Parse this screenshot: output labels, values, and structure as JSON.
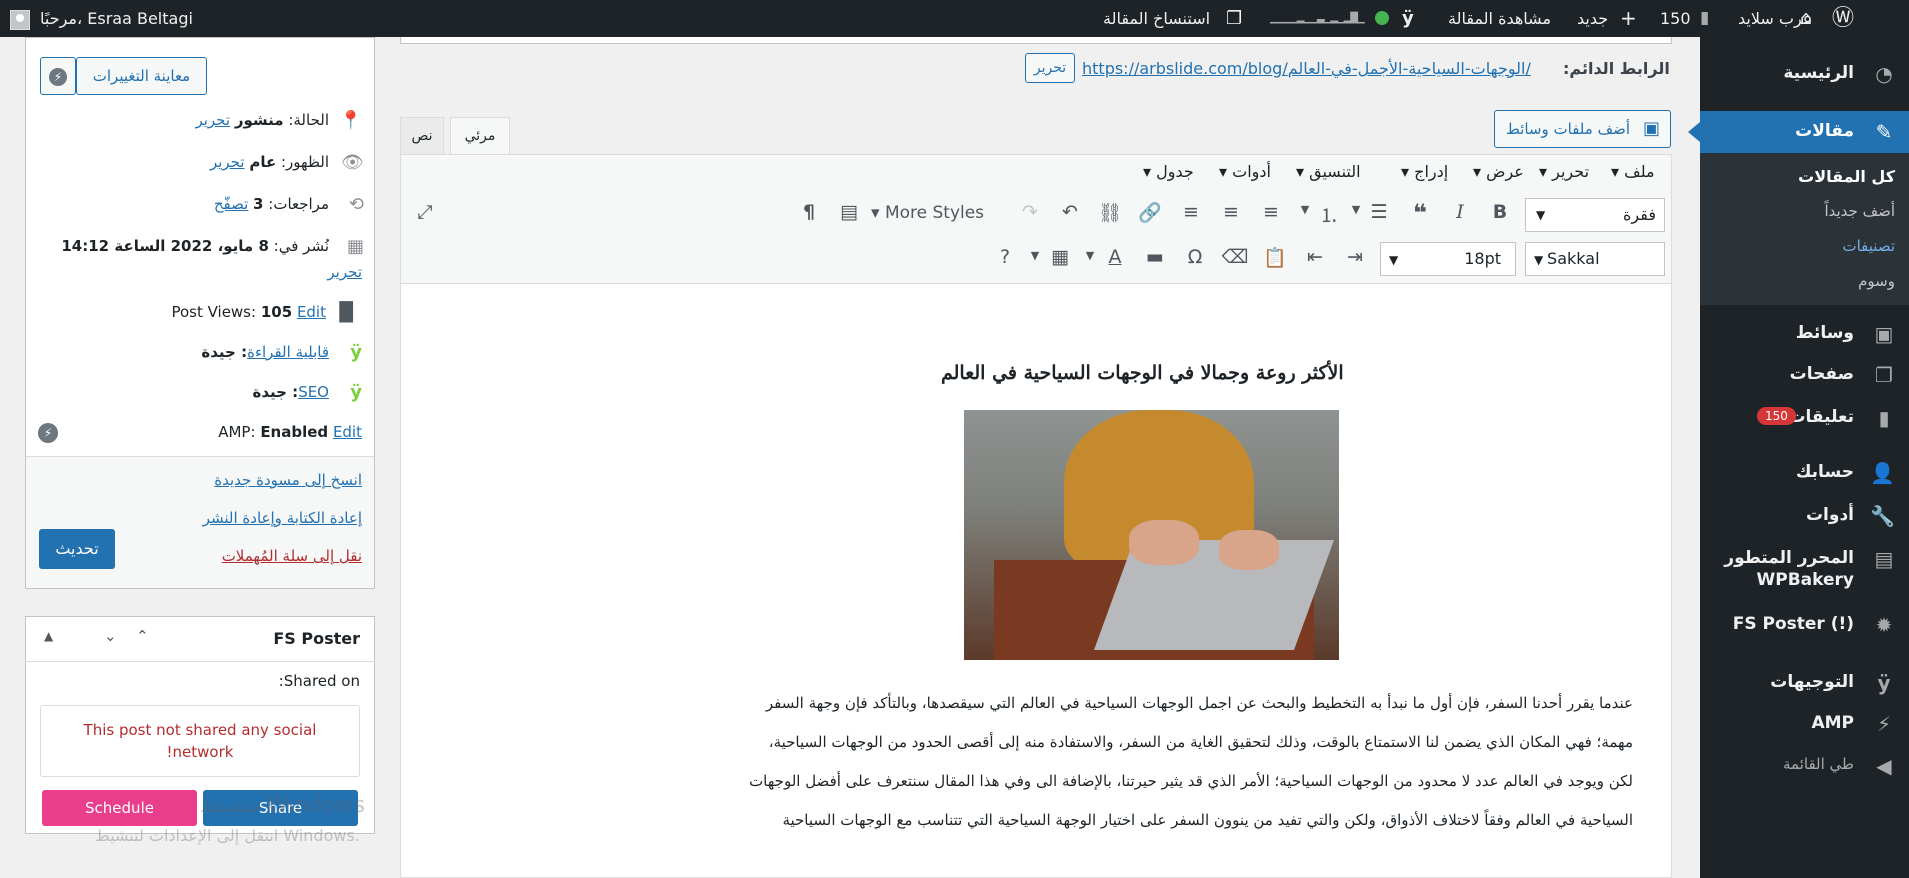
{
  "adminbar": {
    "site_name": "عرب سلايد",
    "updates_count": "150",
    "new_label": "جديد",
    "view_post": "مشاهدة المقالة",
    "clone_post": "استنساخ المقالة",
    "greeting": "مرحبًا، Esraa Beltagi"
  },
  "menu": {
    "items": [
      {
        "label": "الرئيسية",
        "icon": "dashboard-icon"
      },
      {
        "label": "مقالات",
        "icon": "pin-icon"
      },
      {
        "label": "وسائط",
        "icon": "media-icon"
      },
      {
        "label": "صفحات",
        "icon": "pages-icon"
      },
      {
        "label": "تعليقات",
        "icon": "comments-icon",
        "badge": "150"
      },
      {
        "label": "حسابك",
        "icon": "user-icon"
      },
      {
        "label": "أدوات",
        "icon": "wrench-icon"
      },
      {
        "label": "المحرر المتطور",
        "label2": "WPBakery",
        "icon": "wpbakery-icon"
      },
      {
        "label": "FS Poster (!)",
        "icon": "fs-poster-icon"
      },
      {
        "label": "التوجيهات",
        "icon": "yoast-icon"
      },
      {
        "label": "AMP",
        "icon": "amp-icon"
      },
      {
        "label": "طي القائمة",
        "icon": "collapse-icon"
      }
    ],
    "submenu": [
      "كل المقالات",
      "أضف جديداً",
      "تصنيفات",
      "وسوم"
    ]
  },
  "editor": {
    "permalink_label": "الرابط الدائم:",
    "permalink_url": "https://arbslide.com/blog/الوجهات-السياحية-الأجمل-في-العالم/",
    "permalink_edit": "تحرير",
    "add_media": "أضف ملفات وسائط",
    "tab_visual": "مرئي",
    "tab_text": "نص",
    "menubar": [
      "ملف",
      "تحرير",
      "عرض",
      "إدراج",
      "التنسيق",
      "أدوات",
      "جدول"
    ],
    "format_select": "فقرة",
    "more_styles": "More Styles",
    "font_select": "Sakkal Majalla",
    "size_select": "18pt",
    "heading": "الأكثر روعة وجمالا في الوجهات السياحية في العالم",
    "paragraph_lines": [
      "عندما يقرر أحدنا السفر، فإن أول ما نبدأ به التخطيط  والبحث عن  اجمل الوجهات السياحية في العالم التي سيقصدها، وبالتأكد فإن وجهة السفر",
      "مهمة؛ فهي المكان الذي يضمن لنا الاستمتاع بالوقت، وذلك لتحقيق الغاية من السفر، والاستفادة منه إلى أقصى الحدود من الوجهات السياحية،",
      "لكن ويوجد في العالم عدد لا محدود من الوجهات السياحية؛ الأمر الذي قد يثير حيرتنا،  بالإضافة الى وفي هذا المقال سنتعرف على أفضل الوجهات",
      "السياحية في العالم وفقاً لاختلاف الأذواق،  ولكن والتي تفيد من ينوون السفر على اختيار الوجهة السياحية التي تتناسب مع الوجهات السياحية"
    ]
  },
  "publish": {
    "preview_btn": "معاينة التغييرات",
    "status_label": "الحالة:",
    "status_value": "منشور",
    "status_edit": "تحرير",
    "visibility_label": "الظهور:",
    "visibility_value": "عام",
    "visibility_edit": "تحرير",
    "revisions_label": "مراجعات:",
    "revisions_value": "3",
    "revisions_browse": "تصفّح",
    "published_label": "نُشر في:",
    "published_value": "8 مايو، 2022 الساعة 14:12",
    "published_edit": "تحرير",
    "views_label": "Post Views:",
    "views_value": "105",
    "views_edit": "Edit",
    "readability_label": "قابلية القراءة",
    "readability_value": ": جيدة",
    "seo_label": "SEO",
    "seo_value": ": جيدة",
    "amp_label": "AMP:",
    "amp_value": "Enabled",
    "amp_edit": "Edit",
    "copy_draft": "انسخ إلى مسودة جديدة",
    "rewrite": "إعادة الكتابة وإعادة النشر",
    "trash": "نقل إلى سلة المُهملات",
    "update_btn": "تحديث"
  },
  "fsposter": {
    "title": "FS Poster",
    "shared_on": ":Shared on",
    "message_line1": "This post not shared any social",
    "message_line2": "!network",
    "schedule_btn": "Schedule",
    "share_btn": "Share"
  },
  "watermark": {
    "line1": "تنشيط Windows",
    "line2": "انتقل إلى الإعدادات لتنشيط Windows."
  },
  "colors": {
    "admin_dark": "#1d2327",
    "accent": "#2271b1",
    "badge_red": "#d63638",
    "schedule_pink": "#e83e8c"
  }
}
